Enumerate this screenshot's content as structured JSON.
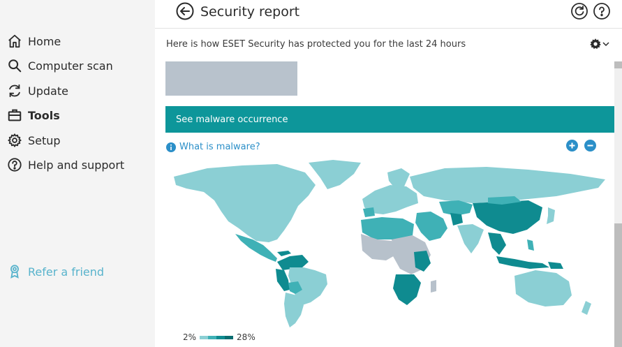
{
  "sidebar": {
    "items": [
      {
        "label": "Home",
        "icon": "home-icon"
      },
      {
        "label": "Computer scan",
        "icon": "search-icon"
      },
      {
        "label": "Update",
        "icon": "refresh-icon"
      },
      {
        "label": "Tools",
        "icon": "briefcase-icon",
        "active": true
      },
      {
        "label": "Setup",
        "icon": "gear-icon"
      },
      {
        "label": "Help and support",
        "icon": "help-icon"
      }
    ],
    "refer": {
      "label": "Refer a friend",
      "icon": "ribbon-icon"
    }
  },
  "header": {
    "title": "Security report"
  },
  "main": {
    "subtitle": "Here is how ESET Security has protected you for the last 24 hours",
    "malware_bar_label": "See malware occurrence",
    "info_link": "What is malware?",
    "legend": {
      "min": "2%",
      "max": "28%"
    }
  },
  "colors": {
    "accent": "#0d969a",
    "map_light": "#8bcfd4",
    "map_mid": "#3fb1b6",
    "map_dark": "#0f8b90",
    "map_gray": "#b7c1cb"
  }
}
